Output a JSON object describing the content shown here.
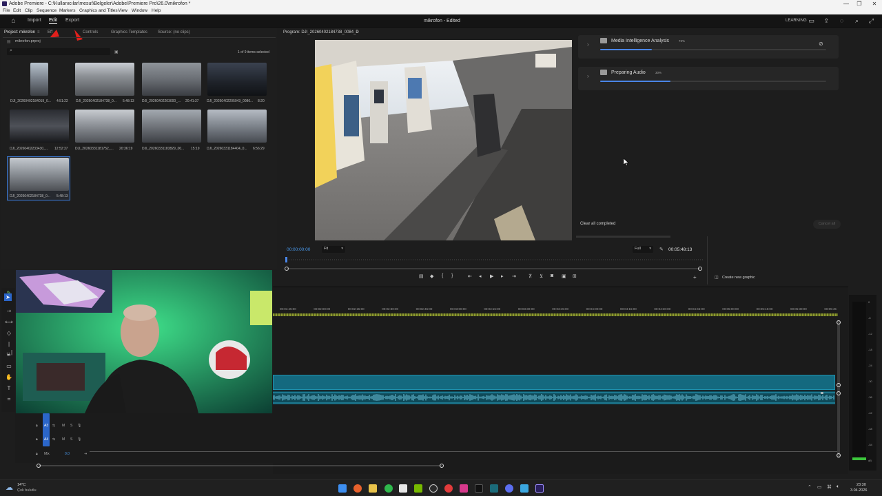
{
  "window": {
    "title": "Adobe Premiere - C:\\Kullanıcılar\\mesut\\Belgeler\\Adobe\\Premiere Pro\\26.0\\mikrofon *",
    "controls": [
      "—",
      "❐",
      "✕"
    ]
  },
  "menu": [
    "File",
    "Edit",
    "Clip",
    "Sequence",
    "Markers",
    "Graphics and Titles",
    "View",
    "Window",
    "Help"
  ],
  "header": {
    "tabs": [
      "Import",
      "Edit",
      "Export"
    ],
    "active_tab": "Edit",
    "doc_title": "mikrofon - Edited",
    "learning": "LEARNING"
  },
  "project_panel": {
    "tabs": [
      "Project: mikrofon",
      "Effect Controls",
      "Graphics Templates",
      "Source: (no clips)"
    ],
    "tab_visible": [
      "Project: mikrofon",
      "Eff",
      "Controls",
      "Graphics Templates",
      "Source: (no clips)"
    ],
    "file": "mikrofon.prproj",
    "selection_info": "1 of 9 items selected",
    "clips": [
      {
        "name": "DJI_20260402184019_0...",
        "duration": "4:51:22"
      },
      {
        "name": "DJI_20260402184738_0...",
        "duration": "5:48:13"
      },
      {
        "name": "DJI_20260402203000_...",
        "duration": "20:41:37"
      },
      {
        "name": "DJI_20260402205043_0086...",
        "duration": "8:20"
      },
      {
        "name": "DJI_20260402233430_...",
        "duration": "12:52:37"
      },
      {
        "name": "DJI_20260331181752_...",
        "duration": "20:36:19"
      },
      {
        "name": "DJI_20260331183829_00...",
        "duration": "15:19"
      },
      {
        "name": "DJI_20260331184404_0...",
        "duration": "6:56:29"
      },
      {
        "name": "DJI_20260402184738_0...",
        "duration": "5:48:13"
      }
    ]
  },
  "program_monitor": {
    "title": "Program: DJI_20260402184738_0084_D",
    "timecode_in": "00:00:00:00",
    "fit": "Fit",
    "quality": "Full",
    "duration": "00:05:48:13"
  },
  "progress_panel": {
    "tasks": [
      {
        "name": "Media Intelligence Analysis",
        "percent_label": "73%",
        "progress": 0.23
      },
      {
        "name": "Preparing Audio",
        "percent_label": "30%",
        "progress": 0.31
      }
    ],
    "clear_label": "Clear all completed",
    "cancel_label": "Cancel all",
    "create_graphic": "Create new graphic"
  },
  "timeline": {
    "timecodes": [
      "00:01:45:00",
      "00:02:00:00",
      "00:02:15:00",
      "00:02:30:00",
      "00:02:45:00",
      "00:03:00:00",
      "00:03:15:00",
      "00:03:30:00",
      "00:03:45:00",
      "00:04:00:00",
      "00:04:15:00",
      "00:04:30:00",
      "00:04:45:00",
      "00:05:00:00",
      "00:05:15:00",
      "00:05:30:00",
      "00:05:45"
    ],
    "tracks": [
      "A3",
      "A4",
      "Mix"
    ],
    "mix_value": "0.0"
  },
  "meter_scale": [
    "0",
    "-6",
    "-12",
    "-18",
    "-24",
    "-30",
    "-36",
    "-42",
    "-48",
    "-54",
    "dB"
  ],
  "taskbar": {
    "weather_temp": "14°C",
    "weather_text": "Çok bulutlu",
    "time": "23:30",
    "date": "3.04.2026"
  },
  "colors": {
    "accent": "#4a86e8",
    "audio_clip": "#14697f",
    "timecode": "#4a9cf0"
  }
}
